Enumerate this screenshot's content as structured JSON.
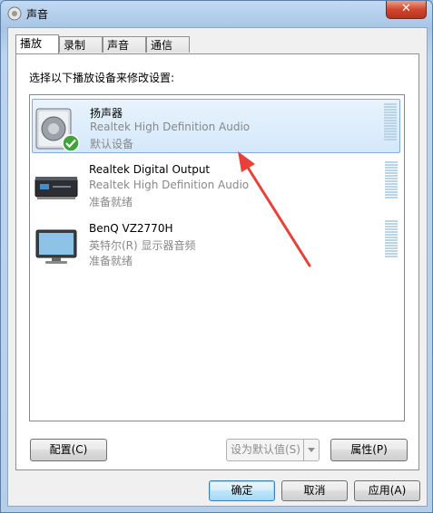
{
  "window": {
    "title": "声音",
    "close_label": "✕"
  },
  "tabs": [
    {
      "label": "播放",
      "active": true
    },
    {
      "label": "录制",
      "active": false
    },
    {
      "label": "声音",
      "active": false
    },
    {
      "label": "通信",
      "active": false
    }
  ],
  "instruction": "选择以下播放设备来修改设置:",
  "devices": [
    {
      "name": "扬声器",
      "description": "Realtek High Definition Audio",
      "status": "默认设备",
      "icon": "speaker-icon",
      "selected": true,
      "default": true
    },
    {
      "name": "Realtek Digital Output",
      "description": "Realtek High Definition Audio",
      "status": "准备就绪",
      "icon": "digital-output-icon",
      "selected": false
    },
    {
      "name": "BenQ VZ2770H",
      "description": "英特尔(R) 显示器音频",
      "status": "准备就绪",
      "icon": "monitor-icon",
      "selected": false
    }
  ],
  "buttons": {
    "configure": "配置(C)",
    "set_default": "设为默认值(S)",
    "properties": "属性(P)",
    "ok": "确定",
    "cancel": "取消",
    "apply": "应用(A)"
  },
  "colors": {
    "selection": "#d4e8fb",
    "annotation_arrow": "#e8413a"
  }
}
